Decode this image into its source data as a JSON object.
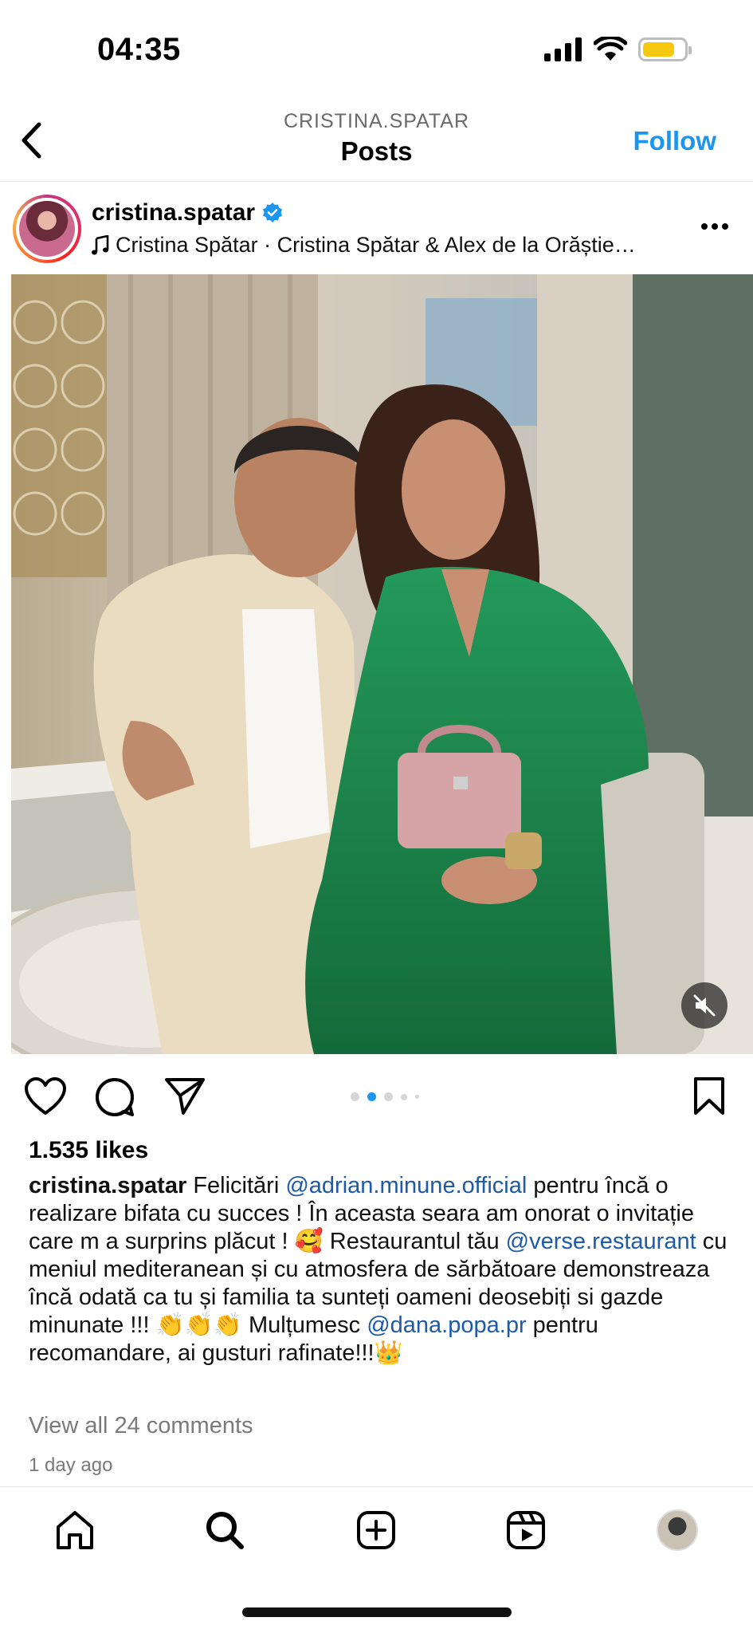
{
  "status_bar": {
    "time": "04:35"
  },
  "nav": {
    "username": "CRISTINA.SPATAR",
    "title": "Posts",
    "follow_label": "Follow"
  },
  "post": {
    "username": "cristina.spatar",
    "audio": "Cristina Spătar · Cristina Spătar & Alex de la Orăștie…",
    "likes": "1.535 likes",
    "caption": {
      "user": "cristina.spatar",
      "t1": " Felicitări ",
      "m1": "@adrian.minune.official",
      "t2": "  pentru încă o realizare bifata cu succes ! În aceasta seara am onorat o invitație care m a surprins plăcut ! 🥰 Restaurantul tău ",
      "m2": "@verse.restaurant",
      "t3": "  cu meniul mediteranean și cu atmosfera de sărbătoare  demonstreaza încă odată ca tu și familia ta sunteți oameni deosebiți si gazde minunate !!! 👏👏👏 Mulțumesc ",
      "m3": "@dana.popa.pr",
      "t4": " pentru recomandare, ai gusturi rafinate!!!👑"
    },
    "comments_link": "View all 24 comments",
    "time_ago": "1 day ago",
    "carousel": {
      "total": 5,
      "active": 2
    }
  },
  "colors": {
    "accent": "#1a96f0",
    "mention": "#1d5aa8",
    "dress": "#1f8a4c",
    "battery": "#f6c90e"
  },
  "icons": {
    "tab_bar": [
      "home-icon",
      "search-icon",
      "create-icon",
      "reels-icon",
      "profile-avatar"
    ],
    "actions": [
      "heart-icon",
      "comment-icon",
      "share-icon",
      "bookmark-icon"
    ]
  }
}
